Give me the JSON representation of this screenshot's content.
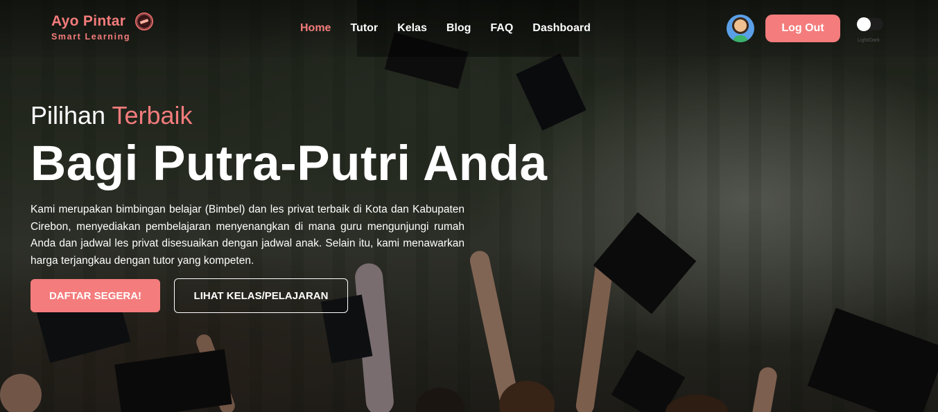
{
  "brand": {
    "name": "Ayo Pintar",
    "tagline": "Smart Learning",
    "accent_color": "#f47c7c"
  },
  "nav": {
    "links": [
      {
        "label": "Home",
        "active": true
      },
      {
        "label": "Tutor",
        "active": false
      },
      {
        "label": "Kelas",
        "active": false
      },
      {
        "label": "Blog",
        "active": false
      },
      {
        "label": "FAQ",
        "active": false
      },
      {
        "label": "Dashboard",
        "active": false
      }
    ],
    "logout_label": "Log Out",
    "theme_toggle_label": "Light/Dark",
    "avatar_icon": "user-avatar-icon"
  },
  "hero": {
    "kicker_plain": "Pilihan",
    "kicker_accent": "Terbaik",
    "title": "Bagi Putra-Putri Anda",
    "description": "Kami merupakan bimbingan belajar (Bimbel) dan les privat terbaik di Kota dan Kabupaten Cirebon, menyediakan pembelajaran menyenangkan di mana guru mengunjungi rumah Anda dan jadwal les privat disesuaikan dengan jadwal anak. Selain itu, kami menawarkan harga terjangkau dengan tutor yang kompeten.",
    "primary_cta": "DAFTAR SEGERA!",
    "secondary_cta": "LIHAT KELAS/PELAJARAN"
  }
}
